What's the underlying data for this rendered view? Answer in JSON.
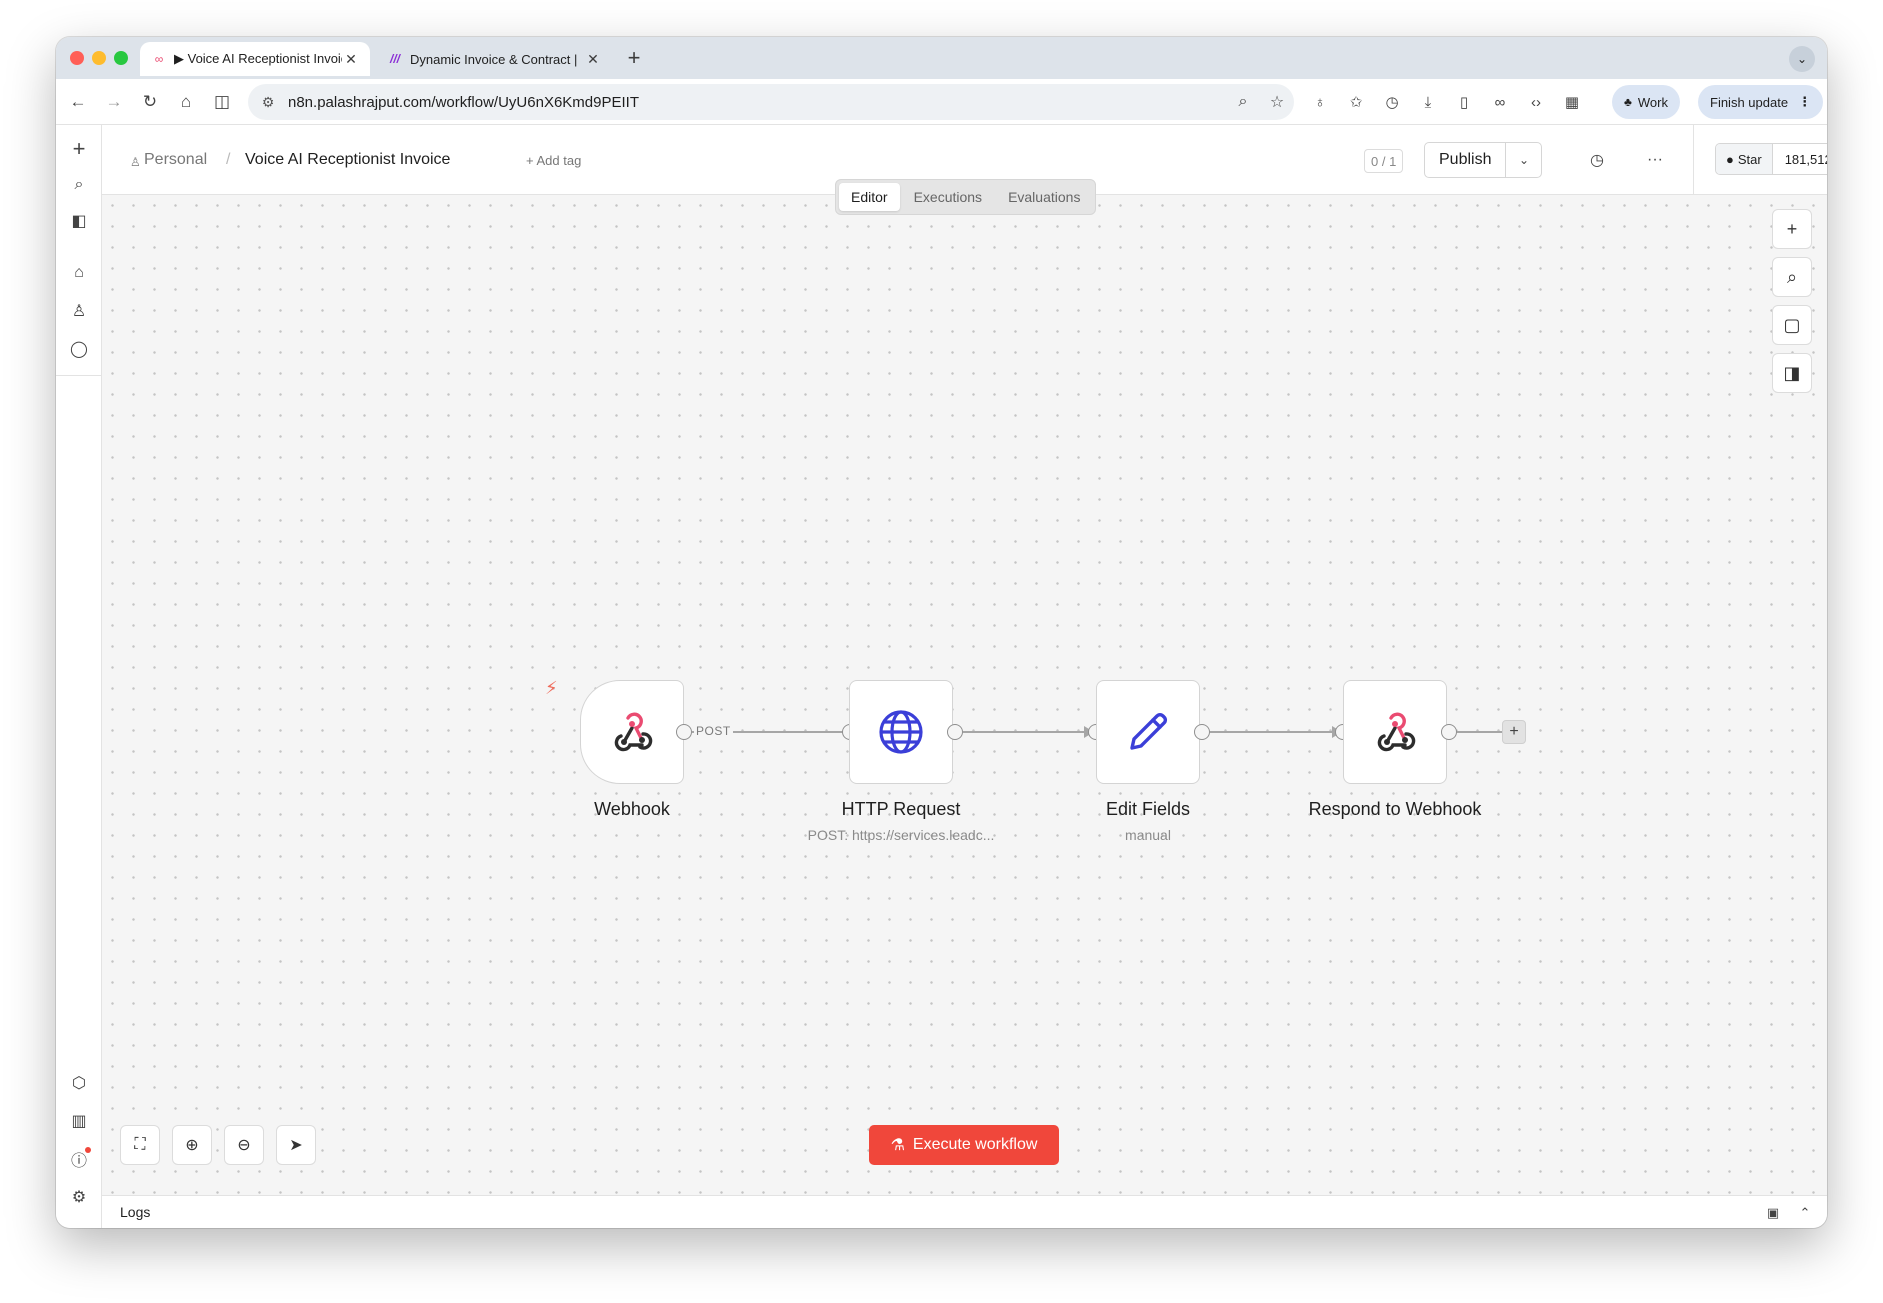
{
  "browser": {
    "tabs": [
      {
        "title": "▶ Voice AI Receptionist Invoic",
        "active": true,
        "favicon": "n8n-icon"
      },
      {
        "title": "Dynamic Invoice & Contract |",
        "active": false,
        "favicon": "make-icon"
      }
    ],
    "url": "n8n.palashrajput.com/workflow/UyU6nX6Kmd9PEIIT",
    "profile_chip": "Work",
    "update_chip": "Finish update",
    "icons": {
      "new_tab": "+",
      "back": "←",
      "forward": "→",
      "reload": "↻",
      "home": "⌂",
      "sidebar": "◫",
      "tab_search": "⌄"
    }
  },
  "header": {
    "project": "Personal",
    "separator": "/",
    "workflow_name": "Voice AI Receptionist Invoice",
    "add_tag": "+ Add tag",
    "counter": "0 / 1",
    "publish": "Publish",
    "github_star": "Star",
    "github_count": "181,512"
  },
  "view_tabs": [
    {
      "label": "Editor",
      "active": true
    },
    {
      "label": "Executions",
      "active": false
    },
    {
      "label": "Evaluations",
      "active": false
    }
  ],
  "workflow": {
    "nodes": [
      {
        "label": "Webhook",
        "subtitle": "",
        "icon": "webhook-icon"
      },
      {
        "label": "HTTP Request",
        "subtitle": "POST: https://services.leadc...",
        "icon": "globe-icon"
      },
      {
        "label": "Edit Fields",
        "subtitle": "manual",
        "icon": "pencil-icon"
      },
      {
        "label": "Respond to Webhook",
        "subtitle": "",
        "icon": "webhook-icon"
      }
    ],
    "edge_label": "POST"
  },
  "execute_button": "Execute workflow",
  "logs_label": "Logs",
  "colors": {
    "accent": "#f0473b",
    "webhook_red": "#ea4b71",
    "globe_blue": "#3b3fd8",
    "pencil_blue": "#3b3fd8"
  }
}
